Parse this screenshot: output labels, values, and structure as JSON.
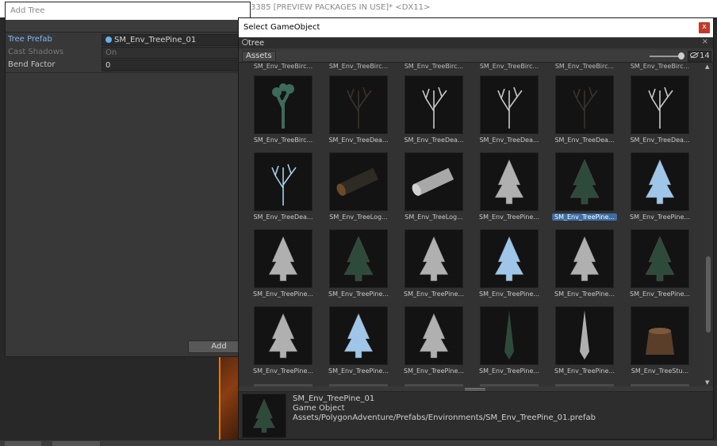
{
  "background": {
    "title_text": "3385 [PREVIEW PACKAGES IN USE]* <DX11>"
  },
  "add_tree": {
    "title": "Add Tree",
    "fields": [
      {
        "label": "Tree Prefab",
        "value": "SM_Env_TreePine_01"
      },
      {
        "label": "Cast Shadows",
        "value": "On"
      },
      {
        "label": "Bend Factor",
        "value": "0"
      }
    ],
    "add_label": "Add"
  },
  "select_gameobject": {
    "title": "Select GameObject",
    "close_label": "x",
    "search": {
      "value": "tree",
      "placeholder": ""
    },
    "clear_label": "×",
    "assets_tab": "Assets",
    "hidden_count": "14",
    "previous_row_labels": [
      "SM_Env_TreeBirc...",
      "SM_Env_TreeBirc...",
      "SM_Env_TreeBirc...",
      "SM_Env_TreeBirc...",
      "SM_Env_TreeBirc...",
      "SM_Env_TreeBirc..."
    ],
    "rows": [
      [
        {
          "label": "SM_Env_TreeBirc...",
          "kind": "birch"
        },
        {
          "label": "SM_Env_TreeDea...",
          "kind": "dead-dark"
        },
        {
          "label": "SM_Env_TreeDea...",
          "kind": "dead-white"
        },
        {
          "label": "SM_Env_TreeDea...",
          "kind": "dead-white"
        },
        {
          "label": "SM_Env_TreeDea...",
          "kind": "dead-dark"
        },
        {
          "label": "SM_Env_TreeDea...",
          "kind": "dead-white"
        }
      ],
      [
        {
          "label": "SM_Env_TreeDea...",
          "kind": "dead-blue"
        },
        {
          "label": "SM_Env_TreeLog...",
          "kind": "log-dark"
        },
        {
          "label": "SM_Env_TreeLog...",
          "kind": "log-grey"
        },
        {
          "label": "SM_Env_TreePine...",
          "kind": "pine-grey"
        },
        {
          "label": "SM_Env_TreePine...",
          "kind": "pine-green",
          "selected": true
        },
        {
          "label": "SM_Env_TreePine...",
          "kind": "pine-blue"
        }
      ],
      [
        {
          "label": "SM_Env_TreePine...",
          "kind": "pine-grey"
        },
        {
          "label": "SM_Env_TreePine...",
          "kind": "pine-green"
        },
        {
          "label": "SM_Env_TreePine...",
          "kind": "pine-grey"
        },
        {
          "label": "SM_Env_TreePine...",
          "kind": "pine-blue"
        },
        {
          "label": "SM_Env_TreePine...",
          "kind": "pine-grey"
        },
        {
          "label": "SM_Env_TreePine...",
          "kind": "pine-green"
        }
      ],
      [
        {
          "label": "SM_Env_TreePine...",
          "kind": "pine-grey"
        },
        {
          "label": "SM_Env_TreePine...",
          "kind": "pine-blue"
        },
        {
          "label": "SM_Env_TreePine...",
          "kind": "pine-grey"
        },
        {
          "label": "SM_Env_TreePine...",
          "kind": "spike-green"
        },
        {
          "label": "SM_Env_TreePine...",
          "kind": "spike-grey"
        },
        {
          "label": "SM_Env_TreeStu...",
          "kind": "stump"
        }
      ]
    ],
    "details": {
      "name": "SM_Env_TreePine_01",
      "type": "Game Object",
      "path": "Assets/PolygonAdventure/Prefabs/Environments/SM_Env_TreePine_01.prefab"
    },
    "colors": {
      "pine_green": "#2e4a3a",
      "pine_grey": "#b0b0b0",
      "pine_blue": "#9fc6e8",
      "selection": "#3d6ea5",
      "close": "#c0392b"
    }
  }
}
